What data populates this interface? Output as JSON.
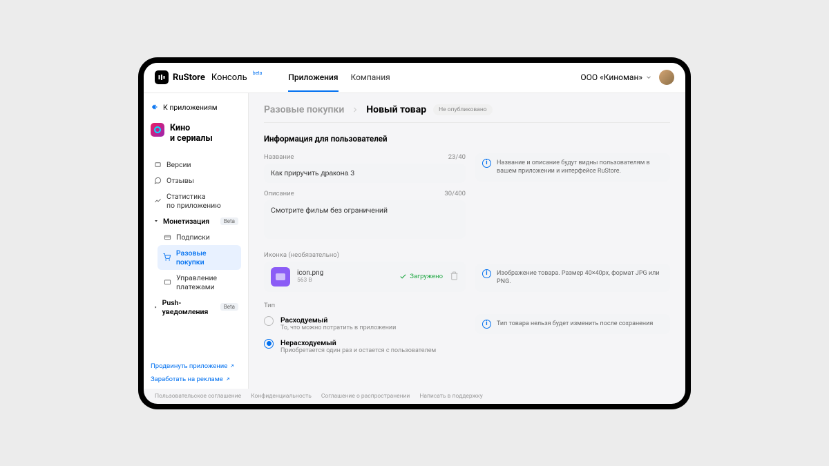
{
  "header": {
    "brand": "RuStore",
    "console": "Консоль",
    "beta": "beta",
    "tabs": [
      {
        "label": "Приложения",
        "active": true
      },
      {
        "label": "Компания",
        "active": false
      }
    ],
    "company": "ООО «Киноман»"
  },
  "sidebar": {
    "back": "К приложениям",
    "app_name": "Кино\nи сериалы",
    "items": {
      "versions": "Версии",
      "reviews": "Отзывы",
      "stats": "Статистика\nпо приложению"
    },
    "monetization": {
      "label": "Монетизация",
      "badge": "Beta",
      "subscriptions": "Подписки",
      "purchases": "Разовые покупки",
      "payments": "Управление\nплатежами"
    },
    "push": {
      "label": "Push-уведомления",
      "badge": "Beta"
    },
    "promo1": "Продвинуть приложение",
    "promo2": "Заработать на рекламе"
  },
  "breadcrumb": {
    "parent": "Разовые покупки",
    "current": "Новый товар",
    "status": "Не опубликовано"
  },
  "section_title": "Информация для пользователей",
  "name_field": {
    "label": "Название",
    "counter": "23/40",
    "value": "Как приручить дракона 3"
  },
  "desc_field": {
    "label": "Описание",
    "counter": "30/400",
    "value": "Смотрите фильм без ограничений"
  },
  "info_name": "Название и описание будут видны пользователям в вашем приложении и интерфейсе RuStore.",
  "icon_field": {
    "label": "Иконка (необязательно)",
    "file_name": "icon.png",
    "file_size": "563 B",
    "status": "Загружено"
  },
  "info_icon": "Изображение товара. Размер 40×40px, формат JPG или PNG.",
  "type_field": {
    "label": "Тип",
    "consumable": {
      "title": "Расходуемый",
      "desc": "То, что можно потратить в приложении"
    },
    "nonconsumable": {
      "title": "Нерасходуемый",
      "desc": "Приобретается один раз и остается с пользователем"
    }
  },
  "info_type": "Тип товара нельзя будет изменить после сохранения",
  "footer": {
    "agreement": "Пользовательское соглашение",
    "privacy": "Конфиденциальность",
    "distribution": "Соглашение о распространении",
    "support": "Написать в поддержку"
  }
}
